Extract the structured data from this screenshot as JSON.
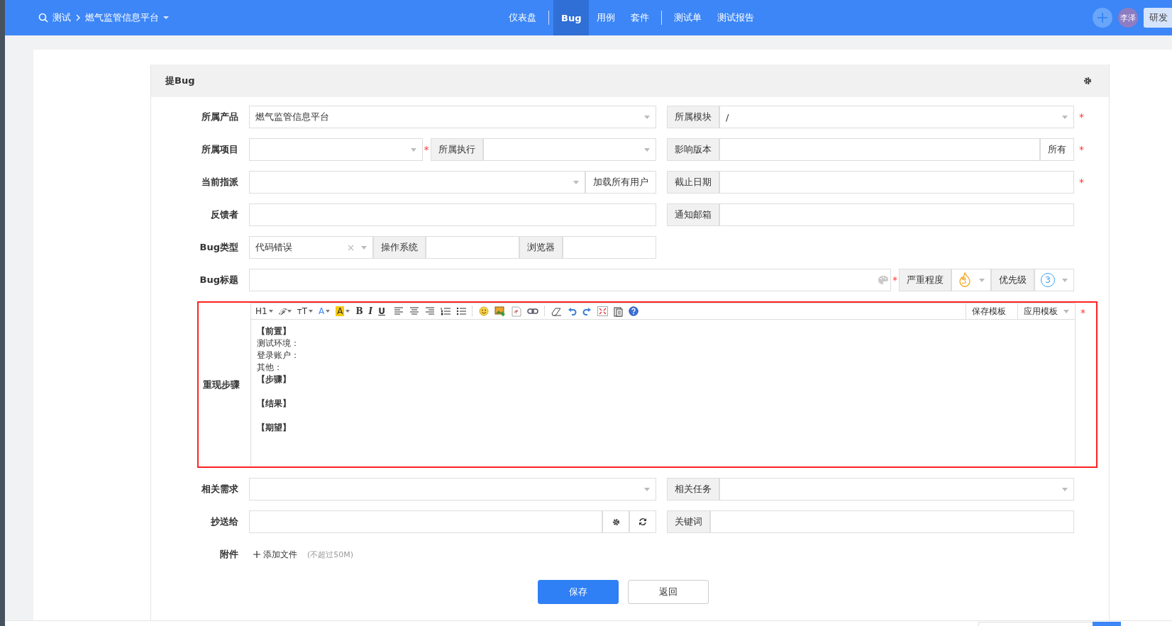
{
  "nav": {
    "breadcrumb": [
      {
        "label": "测试"
      },
      {
        "label": "燃气监管信息平台"
      }
    ],
    "menu_groups": [
      [
        {
          "label": "仪表盘",
          "selected": false
        }
      ],
      [
        {
          "label": "Bug",
          "selected": true
        },
        {
          "label": "用例",
          "selected": false
        },
        {
          "label": "套件",
          "selected": false
        }
      ],
      [
        {
          "label": "测试单",
          "selected": false
        },
        {
          "label": "测试报告",
          "selected": false
        }
      ]
    ],
    "avatar": "李泽",
    "button": "研发"
  },
  "panel": {
    "title": "提Bug"
  },
  "fields": {
    "product": {
      "label": "所属产品",
      "value": "燃气监管信息平台"
    },
    "module": {
      "label": "所属模块",
      "value": "/",
      "required_mark": "*"
    },
    "project": {
      "label": "所属项目",
      "required_mark": "*"
    },
    "execution": {
      "label": "所属执行"
    },
    "build": {
      "label": "影响版本",
      "addon": "所有",
      "required_mark": "*"
    },
    "assigned": {
      "label": "当前指派",
      "addon": "加载所有用户"
    },
    "deadline": {
      "label": "截止日期",
      "required_mark": "*"
    },
    "feedback": {
      "label": "反馈者"
    },
    "notify": {
      "label": "通知邮箱"
    },
    "type": {
      "label": "Bug类型",
      "value": "代码错误"
    },
    "os": {
      "label": "操作系统"
    },
    "browser": {
      "label": "浏览器"
    },
    "title": {
      "label": "Bug标题",
      "required_mark": "*"
    },
    "severity": {
      "label": "严重程度",
      "value": "3"
    },
    "priority": {
      "label": "优先级",
      "value": "3"
    },
    "steps": {
      "label": "重现步骤",
      "required_mark": "*",
      "format_buttons": [
        {
          "kind": "heading",
          "label": "H1"
        },
        {
          "kind": "font",
          "label": "ℱ"
        },
        {
          "kind": "size",
          "label": "ᴛT"
        },
        {
          "kind": "color",
          "label": "A"
        },
        {
          "kind": "highlight",
          "label": "A"
        },
        {
          "kind": "bold",
          "label": "B"
        },
        {
          "kind": "italic",
          "label": "I"
        },
        {
          "kind": "underline",
          "label": "U"
        }
      ],
      "template_buttons": [
        "保存模板",
        "应用模板"
      ],
      "paragraphs": [
        [
          {
            "text": "【前置】",
            "bold": true
          },
          {
            "text": "测试环境：",
            "bold": false
          },
          {
            "text": "登录账户：",
            "bold": false
          },
          {
            "text": "其他：",
            "bold": false
          },
          {
            "text": "【步骤】",
            "bold": true
          }
        ],
        [
          {
            "text": "【结果】",
            "bold": true
          }
        ],
        [
          {
            "text": "【期望】",
            "bold": true
          }
        ]
      ]
    },
    "story": {
      "label": "相关需求"
    },
    "task": {
      "label": "相关任务"
    },
    "mailto": {
      "label": "抄送给"
    },
    "keywords": {
      "label": "关键词"
    },
    "files": {
      "label": "附件",
      "button": "添加文件",
      "hint": "(不超过50M)"
    }
  },
  "actions": [
    "保存",
    "返回"
  ]
}
